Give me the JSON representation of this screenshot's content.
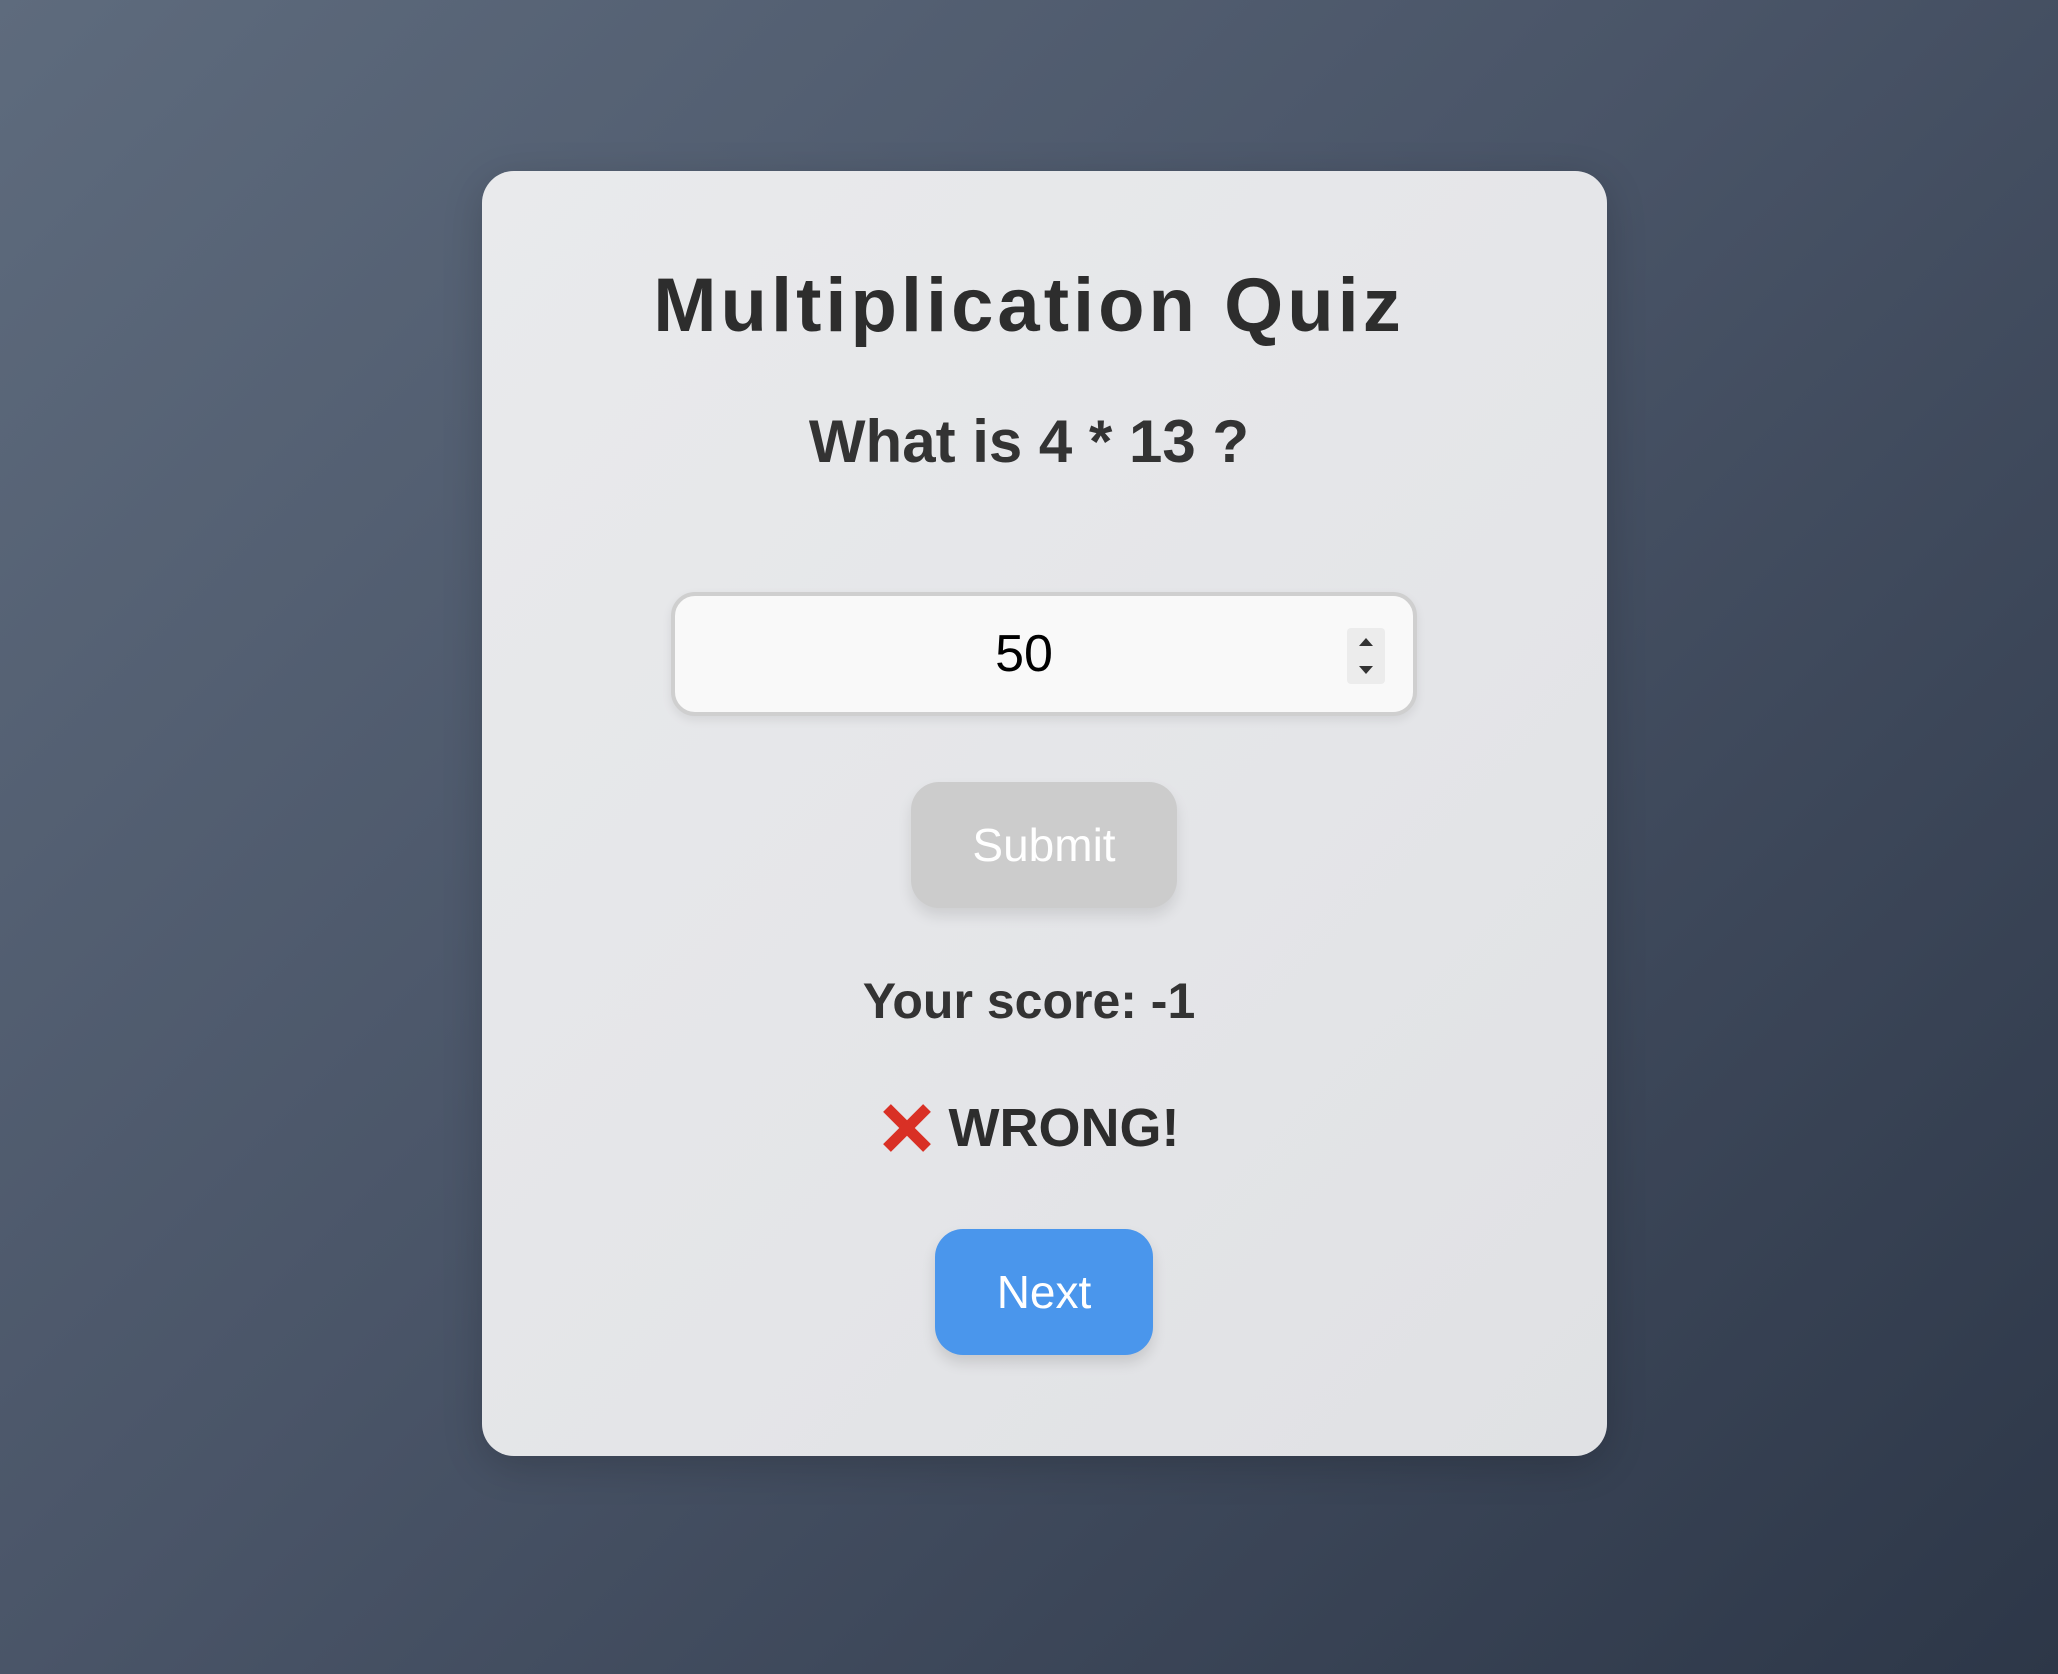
{
  "quiz": {
    "title": "Multiplication Quiz",
    "question": "What is 4 * 13 ?",
    "answer_value": "50",
    "submit_label": "Submit",
    "score_text": "Your score: -1",
    "feedback_text": "WRONG!",
    "next_label": "Next"
  },
  "icons": {
    "feedback_icon": "cross-mark-icon",
    "spinner_up": "caret-up-icon",
    "spinner_down": "caret-down-icon"
  },
  "colors": {
    "next_button": "#4a96ec",
    "submit_button_disabled": "#cccccc",
    "wrong_mark": "#d93025"
  }
}
